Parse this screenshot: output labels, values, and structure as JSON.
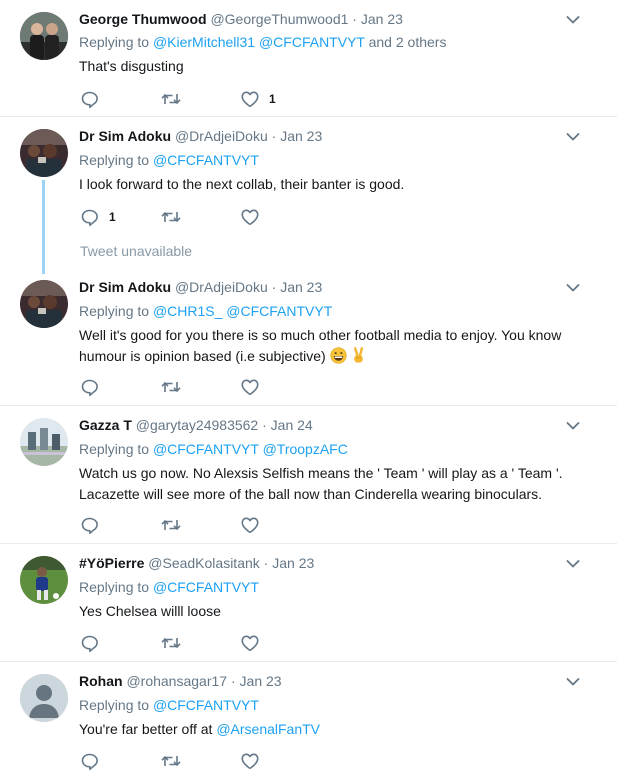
{
  "tweets": [
    {
      "name": "George Thumwood",
      "handle": "@GeorgeThumwood1",
      "dot": "·",
      "time": "Jan 23",
      "replying_prefix": "Replying to ",
      "replying_to": [
        "@KierMitchell31",
        "@CFCFANTVYT"
      ],
      "replying_suffix": " and 2 others",
      "text": "That's disgusting",
      "reply_count": "",
      "like_count": "1"
    },
    {
      "name": "Dr Sim Adoku",
      "handle": "@DrAdjeiDoku",
      "dot": "·",
      "time": "Jan 23",
      "replying_prefix": "Replying to ",
      "replying_to": [
        "@CFCFANTVYT"
      ],
      "text": "I look forward to the next collab, their banter is good.",
      "reply_count": "1",
      "like_count": ""
    },
    {
      "name": "Dr Sim Adoku",
      "handle": "@DrAdjeiDoku",
      "dot": "·",
      "time": "Jan 23",
      "replying_prefix": "Replying to ",
      "replying_to": [
        "@CHR1S_",
        "@CFCFANTVYT"
      ],
      "text_line1": "Well it's good for you there is so much other football media to enjoy. You know",
      "text_line2": "humour is opinion based (i.e subjective) ",
      "emojis": [
        "grinning-face",
        "victory-hand"
      ],
      "reply_count": "",
      "like_count": ""
    },
    {
      "name": "Gazza T",
      "handle": "@garytay24983562",
      "dot": "·",
      "time": "Jan 24",
      "replying_prefix": "Replying to ",
      "replying_to": [
        "@CFCFANTVYT",
        "@TroopzAFC"
      ],
      "text_line1": "Watch us go now. No Alexsis Selfish means the ' Team ' will play as a ' Team '.",
      "text_line2": "Lacazette will see more of the ball now than Cinderella wearing binoculars.",
      "reply_count": "",
      "like_count": ""
    },
    {
      "name": "#YöPierre",
      "handle": "@SeadKolasitank",
      "dot": "·",
      "time": "Jan 23",
      "replying_prefix": "Replying to ",
      "replying_to": [
        "@CFCFANTVYT"
      ],
      "text": "Yes Chelsea willl loose",
      "reply_count": "",
      "like_count": ""
    },
    {
      "name": "Rohan",
      "handle": "@rohansagar17",
      "dot": "·",
      "time": "Jan 23",
      "replying_prefix": "Replying to ",
      "replying_to": [
        "@CFCFANTVYT"
      ],
      "text_prefix": "You're far better off at ",
      "text_mention": "@ArsenalFanTV",
      "reply_count": "",
      "like_count": ""
    }
  ],
  "unavailable_text": "Tweet unavailable",
  "colors": {
    "link": "#1da1f2",
    "secondary": "#657786",
    "thread_line": "#9ad3f5",
    "divider": "#e6ecf0"
  },
  "icons": {
    "reply": "reply-icon",
    "retweet": "retweet-icon",
    "like": "heart-icon",
    "more": "chevron-down-icon"
  }
}
